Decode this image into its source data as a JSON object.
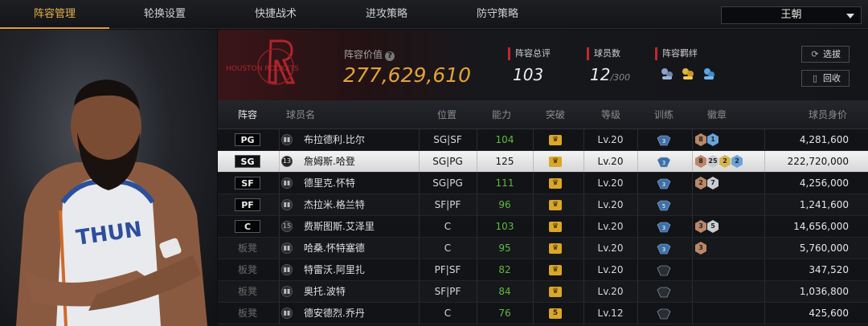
{
  "tabs": [
    {
      "label": "阵容管理",
      "active": true
    },
    {
      "label": "轮换设置",
      "active": false
    },
    {
      "label": "快捷战术",
      "active": false
    },
    {
      "label": "进攻策略",
      "active": false
    },
    {
      "label": "防守策略",
      "active": false
    }
  ],
  "team_select": {
    "value": "王朝"
  },
  "header": {
    "team_logo_text": "HOUSTON ROCKETS",
    "team_value_label": "阵容价值",
    "team_value": "277,629,610",
    "overall_label": "阵容总评",
    "overall_value": "103",
    "player_count_label": "球员数",
    "player_count": "12",
    "player_count_max": "/300",
    "bond_label": "阵容羁绊",
    "scout_button": "选拔",
    "recycle_button": "回收"
  },
  "table": {
    "columns": [
      "阵容",
      "球员名",
      "位置",
      "能力",
      "突破",
      "等级",
      "训练",
      "徽章",
      "球员身价"
    ],
    "rows": [
      {
        "slot": "PG",
        "number": "",
        "name": "布拉德利.比尔",
        "position": "SG|SF",
        "ability": "104",
        "breakthrough": "♛",
        "level": "Lv.20",
        "train": "3",
        "badges": [
          {
            "t": "bronze",
            "v": "8"
          },
          {
            "t": "blue",
            "v": "1"
          }
        ],
        "value": "4,281,600",
        "starter": true
      },
      {
        "slot": "SG",
        "number": "13",
        "name": "詹姆斯.哈登",
        "position": "SG|PG",
        "ability": "125",
        "breakthrough": "♛",
        "level": "Lv.20",
        "train": "3",
        "badges": [
          {
            "t": "bronze",
            "v": "8"
          },
          {
            "t": "silver",
            "v": "25"
          },
          {
            "t": "gold",
            "v": "2"
          },
          {
            "t": "blue",
            "v": "2"
          }
        ],
        "value": "222,720,000",
        "starter": true,
        "selected": true
      },
      {
        "slot": "SF",
        "number": "",
        "name": "德里克.怀特",
        "position": "SG|PG",
        "ability": "111",
        "breakthrough": "♛",
        "level": "Lv.20",
        "train": "3",
        "badges": [
          {
            "t": "bronze",
            "v": "2"
          },
          {
            "t": "silver",
            "v": "7"
          }
        ],
        "value": "4,256,000",
        "starter": true
      },
      {
        "slot": "PF",
        "number": "",
        "name": "杰拉米.格兰特",
        "position": "SF|PF",
        "ability": "96",
        "breakthrough": "♛",
        "level": "Lv.20",
        "train": "5",
        "badges": [],
        "value": "1,241,600",
        "starter": true
      },
      {
        "slot": "C",
        "number": "15",
        "name": "费斯图斯.艾泽里",
        "position": "C",
        "ability": "103",
        "breakthrough": "♛",
        "level": "Lv.20",
        "train": "3",
        "badges": [
          {
            "t": "bronze",
            "v": "3"
          },
          {
            "t": "silver",
            "v": "5"
          }
        ],
        "value": "14,656,000",
        "starter": true
      },
      {
        "slot": "板凳",
        "number": "",
        "name": "哈桑.怀特塞德",
        "position": "C",
        "ability": "95",
        "breakthrough": "♛",
        "level": "Lv.20",
        "train": "3",
        "badges": [
          {
            "t": "bronze",
            "v": "3"
          }
        ],
        "value": "5,760,000",
        "starter": false
      },
      {
        "slot": "板凳",
        "number": "",
        "name": "特雷沃.阿里扎",
        "position": "PF|SF",
        "ability": "82",
        "breakthrough": "♛",
        "level": "Lv.20",
        "train": "",
        "badges": [],
        "value": "347,520",
        "starter": false
      },
      {
        "slot": "板凳",
        "number": "",
        "name": "奥托.波特",
        "position": "SF|PF",
        "ability": "84",
        "breakthrough": "♛",
        "level": "Lv.20",
        "train": "",
        "badges": [],
        "value": "1,036,800",
        "starter": false
      },
      {
        "slot": "板凳",
        "number": "",
        "name": "德安德烈.乔丹",
        "position": "C",
        "ability": "76",
        "breakthrough": "5",
        "level": "Lv.12",
        "train": "",
        "badges": [],
        "value": "425,600",
        "starter": false
      }
    ]
  },
  "colors": {
    "accent": "#e1a33a",
    "red": "#c0282e",
    "green": "#5fba3e"
  }
}
